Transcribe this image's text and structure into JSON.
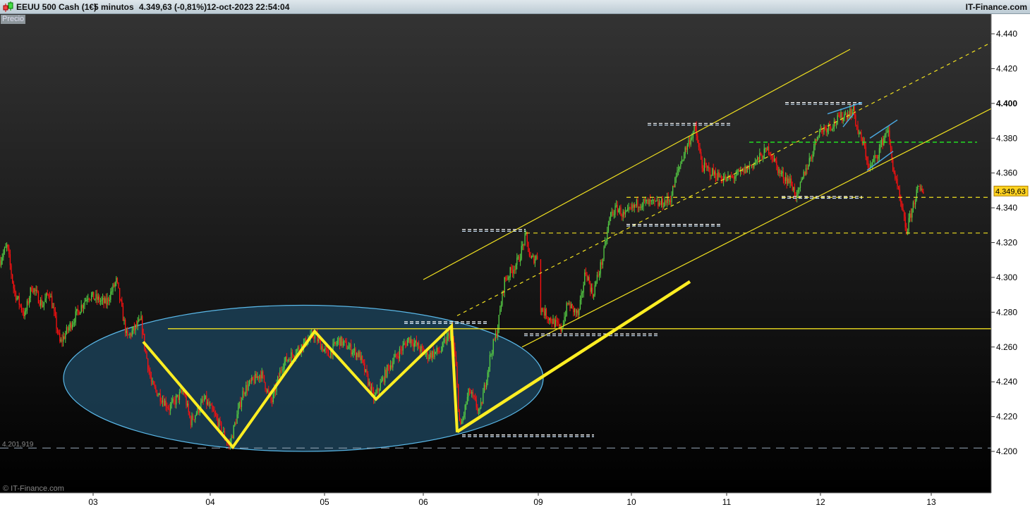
{
  "header": {
    "instrument": "EEUU 500 Cash (1€)",
    "timeframe": "5 minutos",
    "price_change": "4.349,63 (-0,81%)",
    "datetime": "12-oct-2023 22:54:04",
    "brand": "IT-Finance.com"
  },
  "panel_label": "Precio",
  "watermark": "© IT-Finance.com",
  "colors": {
    "up": "#55cc44",
    "down": "#ff1010",
    "drawing": "#f0e020",
    "ellipse_fill": "#1b3d52",
    "ellipse_stroke": "#5ab8e8",
    "green_level": "#22ee22",
    "price_tag": "#ffd21f"
  },
  "chart_data": {
    "type": "candlestick",
    "title": "EEUU 500 Cash (1€) 5 minutos",
    "ylim": [
      4.18,
      4.455
    ],
    "xlim": [
      0,
      1405
    ],
    "x_unit": "bar index",
    "y_ticks": [
      "4.200",
      "4.220",
      "4.240",
      "4.260",
      "4.280",
      "4.300",
      "4.320",
      "4.340",
      "4.360",
      "4.380",
      "4.400",
      "4.420",
      "4.440"
    ],
    "y_tick_values": [
      4.2,
      4.22,
      4.24,
      4.26,
      4.28,
      4.3,
      4.32,
      4.34,
      4.36,
      4.38,
      4.4,
      4.42,
      4.44
    ],
    "x_ticks": [
      "03",
      "04",
      "05",
      "06",
      "09",
      "10",
      "11",
      "12",
      "13"
    ],
    "x_tick_positions": [
      132,
      298,
      460,
      600,
      763,
      895,
      1030,
      1163,
      1320
    ],
    "last_price": 4.34963,
    "last_price_label": "4.349,63",
    "reference_level": 4.201919,
    "reference_label": "4.201,919",
    "price_path": [
      [
        0,
        4.31
      ],
      [
        10,
        4.318
      ],
      [
        20,
        4.292
      ],
      [
        35,
        4.278
      ],
      [
        45,
        4.295
      ],
      [
        60,
        4.284
      ],
      [
        70,
        4.292
      ],
      [
        85,
        4.262
      ],
      [
        110,
        4.28
      ],
      [
        125,
        4.29
      ],
      [
        150,
        4.285
      ],
      [
        165,
        4.298
      ],
      [
        180,
        4.265
      ],
      [
        200,
        4.275
      ],
      [
        205,
        4.26
      ],
      [
        215,
        4.238
      ],
      [
        240,
        4.225
      ],
      [
        260,
        4.235
      ],
      [
        270,
        4.217
      ],
      [
        290,
        4.23
      ],
      [
        305,
        4.22
      ],
      [
        325,
        4.203
      ],
      [
        345,
        4.235
      ],
      [
        370,
        4.245
      ],
      [
        385,
        4.228
      ],
      [
        400,
        4.25
      ],
      [
        420,
        4.258
      ],
      [
        445,
        4.267
      ],
      [
        465,
        4.255
      ],
      [
        480,
        4.264
      ],
      [
        510,
        4.255
      ],
      [
        530,
        4.23
      ],
      [
        550,
        4.248
      ],
      [
        580,
        4.265
      ],
      [
        605,
        4.255
      ],
      [
        625,
        4.258
      ],
      [
        640,
        4.27
      ],
      [
        646,
        4.25
      ],
      [
        652,
        4.212
      ],
      [
        665,
        4.235
      ],
      [
        680,
        4.222
      ],
      [
        695,
        4.255
      ],
      [
        705,
        4.27
      ],
      [
        715,
        4.298
      ],
      [
        735,
        4.31
      ],
      [
        745,
        4.324
      ],
      [
        752,
        4.31
      ],
      [
        762,
        4.312
      ],
      [
        765,
        4.283
      ],
      [
        780,
        4.276
      ],
      [
        795,
        4.27
      ],
      [
        805,
        4.285
      ],
      [
        820,
        4.278
      ],
      [
        830,
        4.304
      ],
      [
        840,
        4.29
      ],
      [
        855,
        4.312
      ],
      [
        865,
        4.336
      ],
      [
        875,
        4.34
      ],
      [
        885,
        4.335
      ],
      [
        905,
        4.343
      ],
      [
        935,
        4.342
      ],
      [
        950,
        4.345
      ],
      [
        960,
        4.36
      ],
      [
        970,
        4.372
      ],
      [
        985,
        4.386
      ],
      [
        990,
        4.375
      ],
      [
        995,
        4.364
      ],
      [
        1010,
        4.36
      ],
      [
        1030,
        4.356
      ],
      [
        1050,
        4.36
      ],
      [
        1070,
        4.366
      ],
      [
        1090,
        4.374
      ],
      [
        1105,
        4.36
      ],
      [
        1120,
        4.355
      ],
      [
        1130,
        4.346
      ],
      [
        1140,
        4.36
      ],
      [
        1150,
        4.37
      ],
      [
        1160,
        4.384
      ],
      [
        1180,
        4.388
      ],
      [
        1195,
        4.393
      ],
      [
        1210,
        4.396
      ],
      [
        1215,
        4.385
      ],
      [
        1225,
        4.375
      ],
      [
        1232,
        4.362
      ],
      [
        1245,
        4.372
      ],
      [
        1258,
        4.386
      ],
      [
        1265,
        4.365
      ],
      [
        1275,
        4.345
      ],
      [
        1285,
        4.326
      ],
      [
        1290,
        4.335
      ],
      [
        1300,
        4.35
      ],
      [
        1310,
        4.35
      ]
    ],
    "drawings": {
      "ellipse": {
        "cx": 430,
        "cy": 4.242,
        "rx": 340,
        "ry": 0.042
      },
      "neckline": {
        "price": 4.2705,
        "x1": 238,
        "x2": 1405
      },
      "zigzag": [
        [
          203,
          4.263
        ],
        [
          330,
          4.2025
        ],
        [
          446,
          4.269
        ],
        [
          533,
          4.23
        ],
        [
          640,
          4.272
        ],
        [
          648,
          4.211
        ]
      ],
      "trend_thick": [
        [
          648,
          4.2113
        ],
        [
          978,
          4.2976
        ]
      ],
      "channel_upper": [
        [
          600,
          4.2987
        ],
        [
          1205,
          4.4311
        ]
      ],
      "channel_mid": [
        [
          648,
          4.278
        ],
        [
          1405,
          4.435
        ]
      ],
      "channel_lower": [
        [
          740,
          4.26
        ],
        [
          1405,
          4.397
        ]
      ],
      "yellow_dashed_levels": [
        {
          "price": 4.3255,
          "x1": 745,
          "x2": 1405
        },
        {
          "price": 4.346,
          "x1": 888,
          "x2": 1405
        }
      ],
      "green_dashed_level": {
        "price": 4.3777,
        "x1": 1062,
        "x2": 1385
      },
      "white_levels": [
        {
          "price": 4.327,
          "x1": 655,
          "x2": 745
        },
        {
          "price": 4.274,
          "x1": 573,
          "x2": 693
        },
        {
          "price": 4.267,
          "x1": 743,
          "x2": 935
        },
        {
          "price": 4.209,
          "x1": 655,
          "x2": 842
        },
        {
          "price": 4.388,
          "x1": 918,
          "x2": 1035
        },
        {
          "price": 4.33,
          "x1": 888,
          "x2": 1022
        },
        {
          "price": 4.4,
          "x1": 1113,
          "x2": 1222
        },
        {
          "price": 4.346,
          "x1": 1108,
          "x2": 1222
        }
      ],
      "blue_lines": [
        [
          [
            1173,
            4.394
          ],
          [
            1222,
            4.4005
          ]
        ],
        [
          [
            1195,
            4.3865
          ],
          [
            1210,
            4.394
          ]
        ],
        [
          [
            1233,
            4.38
          ],
          [
            1272,
            4.3905
          ]
        ],
        [
          [
            1229,
            4.3615
          ],
          [
            1266,
            4.3725
          ]
        ]
      ]
    }
  }
}
